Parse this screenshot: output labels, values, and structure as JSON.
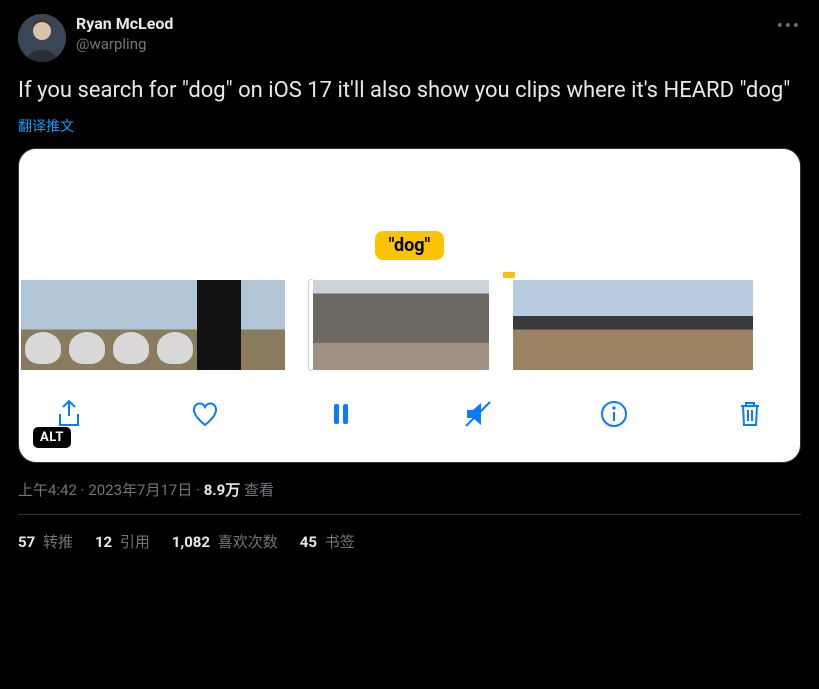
{
  "user": {
    "display_name": "Ryan McLeod",
    "handle": "@warpling"
  },
  "tweet_text": "If you search for \"dog\" on iOS 17 it'll also show you clips where it's HEARD \"dog\"",
  "translate_label": "翻译推文",
  "media": {
    "bubble_text": "\"dog\"",
    "alt_badge": "ALT"
  },
  "meta": {
    "time": "上午4:42",
    "sep": " · ",
    "date": "2023年7月17日",
    "views_value": "8.9万",
    "views_label": " 查看"
  },
  "stats": {
    "retweets_value": "57",
    "retweets_label": " 转推",
    "quotes_value": "12",
    "quotes_label": " 引用",
    "likes_value": "1,082",
    "likes_label": " 喜欢次数",
    "bookmarks_value": "45",
    "bookmarks_label": " 书签"
  }
}
